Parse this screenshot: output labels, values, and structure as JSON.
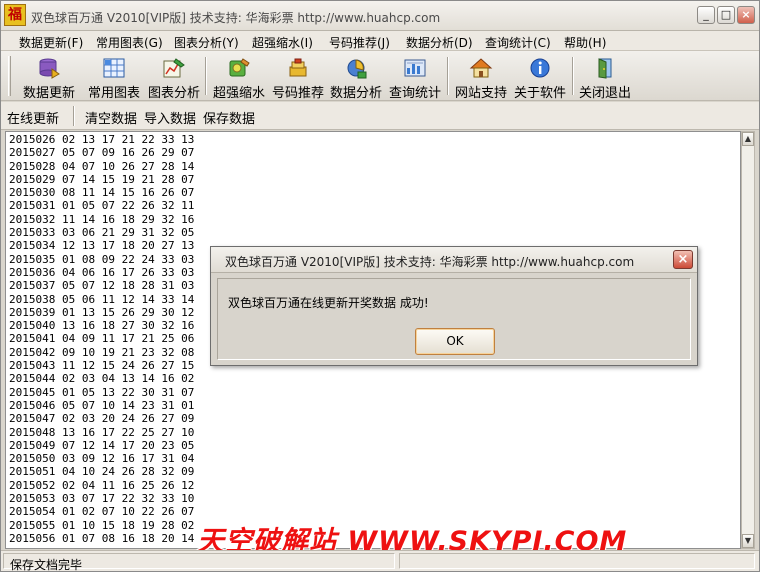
{
  "window": {
    "title": "双色球百万通  V2010[VIP版]  技术支持: 华海彩票 http://www.huahcp.com",
    "app_icon_glyph": "福"
  },
  "menubar": [
    {
      "label": "数据更新(F)"
    },
    {
      "label": "常用图表(G)"
    },
    {
      "label": "图表分析(Y)"
    },
    {
      "label": "超强缩水(I)"
    },
    {
      "label": "号码推荐(J)"
    },
    {
      "label": "数据分析(D)"
    },
    {
      "label": "查询统计(C)"
    },
    {
      "label": "帮助(H)"
    }
  ],
  "toolbar": [
    {
      "label": "数据更新",
      "icon": "database-update-icon"
    },
    {
      "label": "常用图表",
      "icon": "grid-chart-icon"
    },
    {
      "label": "图表分析",
      "icon": "chart-analysis-icon"
    },
    {
      "label": "超强缩水",
      "icon": "filter-icon"
    },
    {
      "label": "号码推荐",
      "icon": "recommend-icon"
    },
    {
      "label": "数据分析",
      "icon": "analysis-icon"
    },
    {
      "label": "查询统计",
      "icon": "statistics-icon"
    },
    {
      "label": "网站支持",
      "icon": "home-icon"
    },
    {
      "label": "关于软件",
      "icon": "info-icon"
    },
    {
      "label": "关闭退出",
      "icon": "exit-door-icon"
    }
  ],
  "subtoolbar": [
    {
      "label": "在线更新"
    },
    {
      "label": "清空数据"
    },
    {
      "label": "导入数据"
    },
    {
      "label": "保存数据"
    }
  ],
  "draws": [
    "2015026 02 13 17 21 22 33 13",
    "2015027 05 07 09 16 26 29 07",
    "2015028 04 07 10 26 27 28 14",
    "2015029 07 14 15 19 21 28 07",
    "2015030 08 11 14 15 16 26 07",
    "2015031 01 05 07 22 26 32 11",
    "2015032 11 14 16 18 29 32 16",
    "2015033 03 06 21 29 31 32 05",
    "2015034 12 13 17 18 20 27 13",
    "2015035 01 08 09 22 24 33 03",
    "2015036 04 06 16 17 26 33 03",
    "2015037 05 07 12 18 28 31 03",
    "2015038 05 06 11 12 14 33 14",
    "2015039 01 13 15 26 29 30 12",
    "2015040 13 16 18 27 30 32 16",
    "2015041 04 09 11 17 21 25 06",
    "2015042 09 10 19 21 23 32 08",
    "2015043 11 12 15 24 26 27 15",
    "2015044 02 03 04 13 14 16 02",
    "2015045 01 05 13 22 30 31 07",
    "2015046 05 07 10 14 23 31 01",
    "2015047 02 03 20 24 26 27 09",
    "2015048 13 16 17 22 25 27 10",
    "2015049 07 12 14 17 20 23 05",
    "2015050 03 09 12 16 17 31 04",
    "2015051 04 10 24 26 28 32 09",
    "2015052 02 04 11 16 25 26 12",
    "2015053 03 07 17 22 32 33 10",
    "2015054 01 02 07 10 22 26 07",
    "2015055 01 10 15 18 19 28 02",
    "2015056 01 07 08 16 18 20 14"
  ],
  "status": {
    "text": "保存文档完毕"
  },
  "watermark": "天空破解站 WWW.SKYPJ.COM",
  "dialog": {
    "title": "双色球百万通  V2010[VIP版]  技术支持: 华海彩票 http://www.huahcp.com",
    "message": "双色球百万通在线更新开奖数据 成功!",
    "ok_label": "OK"
  }
}
